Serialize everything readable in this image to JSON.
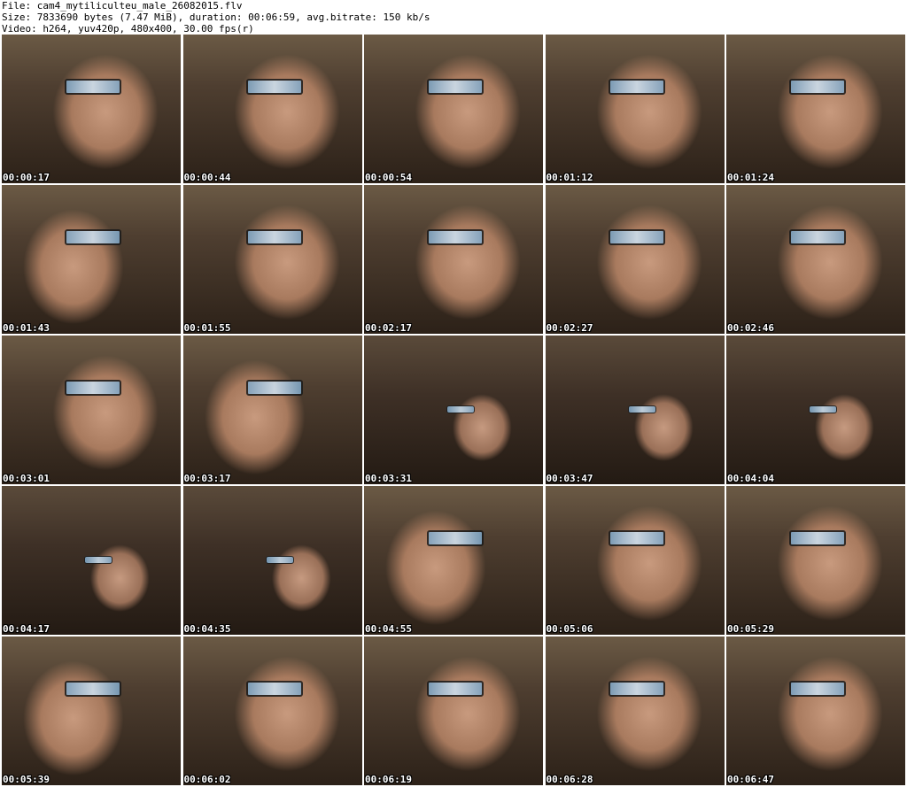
{
  "header": {
    "line1": "File: cam4_mytiliculteu_male_26082015.flv",
    "line2": "Size: 7833690 bytes (7.47 MiB), duration: 00:06:59, avg.bitrate: 150 kb/s",
    "line3": "Video: h264, yuv420p, 480x400, 30.00 fps(r)"
  },
  "thumbnails": [
    {
      "time": "00:00:17",
      "style": "near"
    },
    {
      "time": "00:00:44",
      "style": "near"
    },
    {
      "time": "00:00:54",
      "style": "near"
    },
    {
      "time": "00:01:12",
      "style": "near"
    },
    {
      "time": "00:01:24",
      "style": "near"
    },
    {
      "time": "00:01:43",
      "style": "left"
    },
    {
      "time": "00:01:55",
      "style": "near"
    },
    {
      "time": "00:02:17",
      "style": "near"
    },
    {
      "time": "00:02:27",
      "style": "near"
    },
    {
      "time": "00:02:46",
      "style": "near"
    },
    {
      "time": "00:03:01",
      "style": "near"
    },
    {
      "time": "00:03:17",
      "style": "left"
    },
    {
      "time": "00:03:31",
      "style": "far"
    },
    {
      "time": "00:03:47",
      "style": "far"
    },
    {
      "time": "00:04:04",
      "style": "far"
    },
    {
      "time": "00:04:17",
      "style": "far"
    },
    {
      "time": "00:04:35",
      "style": "far"
    },
    {
      "time": "00:04:55",
      "style": "left"
    },
    {
      "time": "00:05:06",
      "style": "near"
    },
    {
      "time": "00:05:29",
      "style": "near"
    },
    {
      "time": "00:05:39",
      "style": "left"
    },
    {
      "time": "00:06:02",
      "style": "near"
    },
    {
      "time": "00:06:19",
      "style": "near"
    },
    {
      "time": "00:06:28",
      "style": "near"
    },
    {
      "time": "00:06:47",
      "style": "near"
    }
  ]
}
